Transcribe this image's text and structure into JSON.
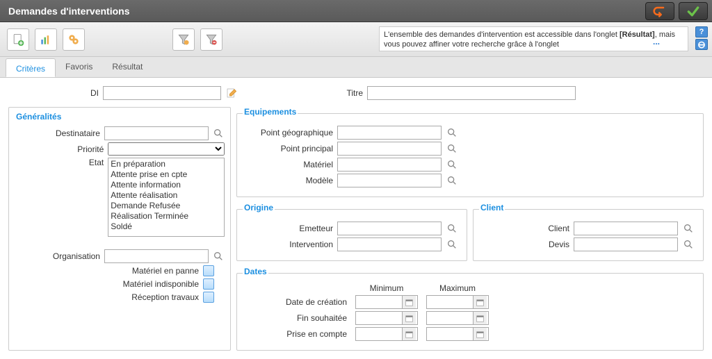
{
  "titlebar": {
    "title": "Demandes d'interventions"
  },
  "hint": {
    "line1": "L'ensemble des demandes d'intervention est accessible dans l'onglet ",
    "bold": "[Résultat]",
    "line2": ", mais vous pouvez affiner votre recherche grâce à l'onglet",
    "more": "..."
  },
  "help": {
    "question": "?",
    "minus": "⊖"
  },
  "tabs": {
    "criteres": "Critères",
    "favoris": "Favoris",
    "resultat": "Résultat"
  },
  "top": {
    "di_label": "DI",
    "di_value": "",
    "titre_label": "Titre",
    "titre_value": ""
  },
  "generalites": {
    "title": "Généralités",
    "destinataire_label": "Destinataire",
    "destinataire_value": "",
    "priorite_label": "Priorité",
    "priorite_value": "",
    "etat_label": "Etat",
    "etat_options": [
      "En préparation",
      "Attente prise en cpte",
      "Attente information",
      "Attente réalisation",
      "Demande Refusée",
      "Réalisation Terminée",
      "Soldé"
    ],
    "organisation_label": "Organisation",
    "organisation_value": "",
    "chk_panne": "Matériel en panne",
    "chk_indispo": "Matériel indisponible",
    "chk_reception": "Réception travaux"
  },
  "equipements": {
    "title": "Equipements",
    "pg_label": "Point géographique",
    "pg_value": "",
    "pp_label": "Point principal",
    "pp_value": "",
    "mat_label": "Matériel",
    "mat_value": "",
    "mod_label": "Modèle",
    "mod_value": ""
  },
  "origine": {
    "title": "Origine",
    "emetteur_label": "Emetteur",
    "emetteur_value": "",
    "intervention_label": "Intervention",
    "intervention_value": ""
  },
  "client": {
    "title": "Client",
    "client_label": "Client",
    "client_value": "",
    "devis_label": "Devis",
    "devis_value": ""
  },
  "dates": {
    "title": "Dates",
    "min_label": "Minimum",
    "max_label": "Maximum",
    "creation_label": "Date de création",
    "fin_label": "Fin souhaitée",
    "prise_label": "Prise en compte"
  }
}
